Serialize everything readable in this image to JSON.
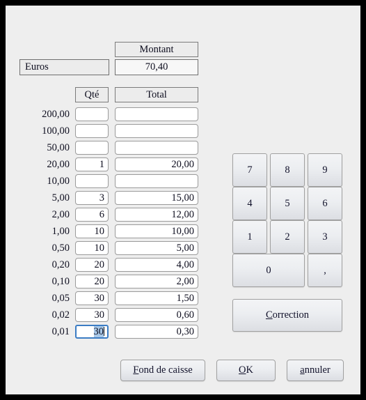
{
  "dialog": {
    "currency_label": "Euros",
    "amount_header": "Montant",
    "amount_value": "70,40",
    "columns": {
      "qty": "Qté",
      "total": "Total"
    },
    "rows": [
      {
        "denomination": "200,00",
        "qty": "",
        "total": ""
      },
      {
        "denomination": "100,00",
        "qty": "",
        "total": ""
      },
      {
        "denomination": "50,00",
        "qty": "",
        "total": ""
      },
      {
        "denomination": "20,00",
        "qty": "1",
        "total": "20,00"
      },
      {
        "denomination": "10,00",
        "qty": "",
        "total": ""
      },
      {
        "denomination": "5,00",
        "qty": "3",
        "total": "15,00"
      },
      {
        "denomination": "2,00",
        "qty": "6",
        "total": "12,00"
      },
      {
        "denomination": "1,00",
        "qty": "10",
        "total": "10,00"
      },
      {
        "denomination": "0,50",
        "qty": "10",
        "total": "5,00"
      },
      {
        "denomination": "0,20",
        "qty": "20",
        "total": "4,00"
      },
      {
        "denomination": "0,10",
        "qty": "20",
        "total": "2,00"
      },
      {
        "denomination": "0,05",
        "qty": "30",
        "total": "1,50"
      },
      {
        "denomination": "0,02",
        "qty": "30",
        "total": "0,60"
      },
      {
        "denomination": "0,01",
        "qty": "30",
        "total": "0,30",
        "focused": true,
        "selected": true
      }
    ],
    "keypad": {
      "keys": [
        "7",
        "8",
        "9",
        "4",
        "5",
        "6",
        "1",
        "2",
        "3"
      ],
      "zero": "0",
      "decimal": ",",
      "correction": {
        "mnemonic": "C",
        "rest": "orrection"
      }
    },
    "buttons": {
      "fond_de_caisse": {
        "mnemonic": "F",
        "rest": "ond de caisse"
      },
      "ok": {
        "mnemonic": "O",
        "rest": "K"
      },
      "cancel": {
        "mnemonic": "a",
        "rest": "nnuler"
      }
    },
    "colors": {
      "window_background": "#eeeeee",
      "frame": "#000000",
      "focus_border": "#3b7cc4",
      "selection": "#a8c8e8",
      "text": "#0d0d1e"
    }
  }
}
